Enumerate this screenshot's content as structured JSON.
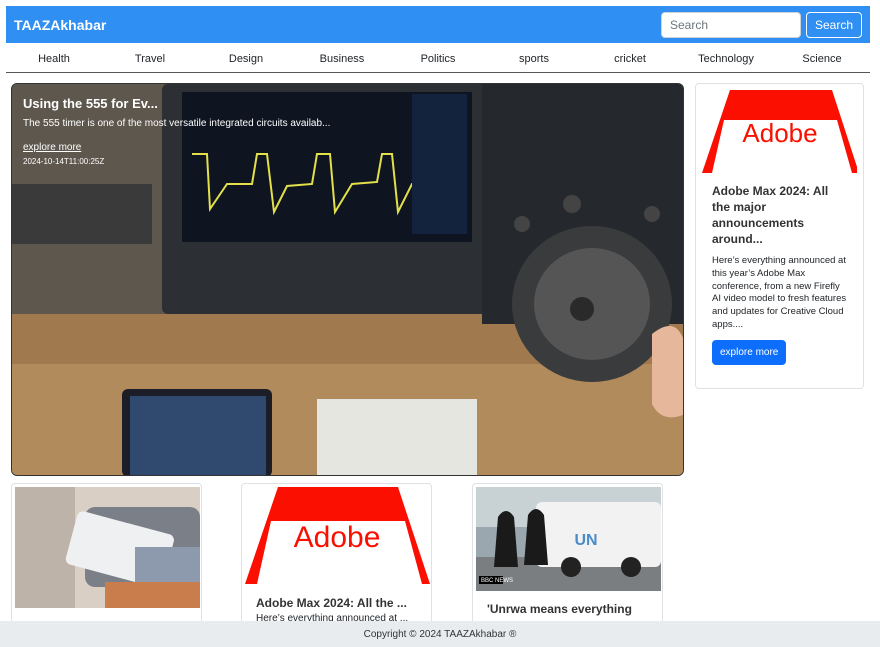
{
  "brand": "TAAZAkhabar",
  "search": {
    "placeholder": "Search",
    "button_label": "Search"
  },
  "categories": [
    "Health",
    "Travel",
    "Design",
    "Business",
    "Politics",
    "sports",
    "cricket",
    "Technology",
    "Science"
  ],
  "hero": {
    "title": "Using the 555 for Ev...",
    "description": "The 555 timer is one of the most versatile integrated circuits availab...",
    "link_label": "explore more",
    "date": "2024-10-14T11:00:25Z"
  },
  "side_card": {
    "logo_text": "Adobe",
    "title": "Adobe Max 2024: All the major announcements around...",
    "description": "Here’s everything announced at this year’s Adobe Max conference, from a new Firefly AI video model to fresh features and updates for Creative Cloud apps....",
    "button_label": "explore more"
  },
  "cards": [
    {
      "title": "",
      "description": ""
    },
    {
      "logo_text": "Adobe",
      "title": "Adobe Max 2024: All the ...",
      "description": "Here’s everything announced at ..."
    },
    {
      "title": "'Unrwa means everything",
      "badge": "BBC NEWS",
      "van_text": "UN"
    }
  ],
  "footer": {
    "text": "Copyright © 2024 TAAZAkhabar ®"
  },
  "colors": {
    "navbar": "#2f8ff3",
    "primary_button": "#0d6efd",
    "adobe_red": "#fa0f00",
    "footer": "#e9ecef"
  }
}
